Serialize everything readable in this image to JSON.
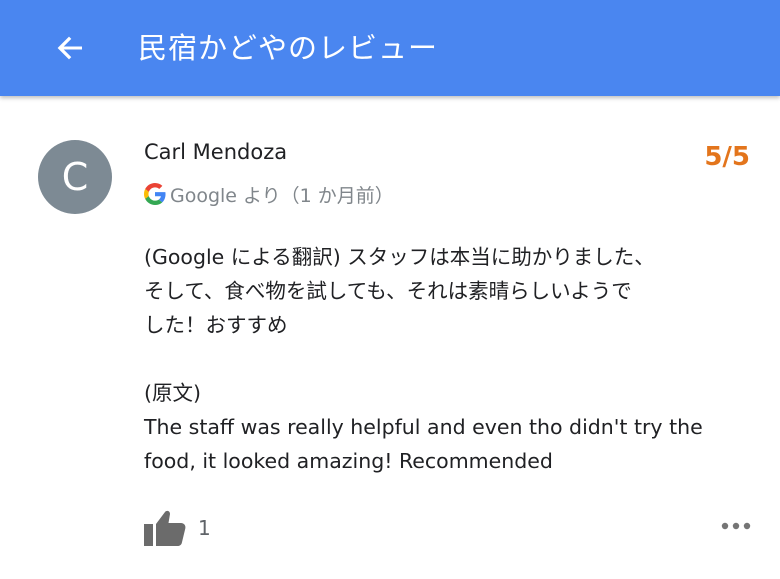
{
  "app_bar": {
    "title": "民宿かどやのレビュー",
    "back_icon": "arrow-back-icon",
    "background": "#4a86f0"
  },
  "review": {
    "avatar_initial": "C",
    "author": "Carl Mendoza",
    "rating": "5/5",
    "rating_color": "#e3751c",
    "source_icon": "google-g-icon",
    "source_text": "Google より（1 か月前）",
    "translated_text": "(Google による翻訳) スタッフは本当に助かりました、\nそして、食べ物を試しても、それは素晴らしいようで\nした！おすすめ",
    "original_label": "(原文)",
    "original_text": "The staff was really helpful and even tho didn't try the\nfood, it looked amazing! Recommended",
    "like_icon": "thumbs-up-icon",
    "like_count": "1",
    "more_icon": "more-horizontal-icon"
  }
}
